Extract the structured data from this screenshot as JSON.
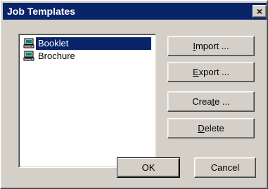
{
  "window": {
    "title": "Job Templates",
    "close_glyph": "×"
  },
  "templates": {
    "items": [
      {
        "label": "Booklet",
        "selected": true,
        "icon": "printer-computer-icon"
      },
      {
        "label": "Brochure",
        "selected": false,
        "icon": "printer-computer-icon"
      }
    ]
  },
  "buttons": {
    "import": {
      "pre": "",
      "acc": "I",
      "post": "mport ..."
    },
    "export": {
      "pre": "",
      "acc": "E",
      "post": "xport ..."
    },
    "create": {
      "pre": "Crea",
      "acc": "t",
      "post": "e ..."
    },
    "delete": {
      "pre": "",
      "acc": "D",
      "post": "elete"
    },
    "ok": "OK",
    "cancel": "Cancel"
  },
  "colors": {
    "titlebar": "#0a246a",
    "selection": "#0a246a",
    "face": "#d4d0c8"
  }
}
